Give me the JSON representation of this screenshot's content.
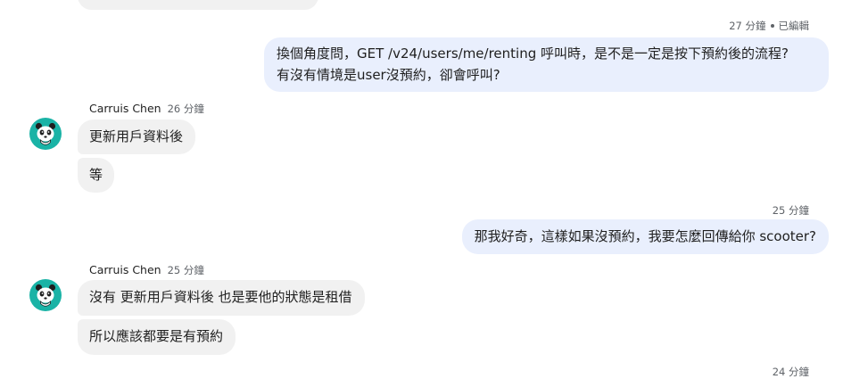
{
  "theme": {
    "incoming_bubble": "#f1f1f1",
    "outgoing_bubble": "#e9effd",
    "avatar_color": "#1ab3a6"
  },
  "messages": {
    "out1": {
      "time": "27 分鐘",
      "status": "已編輯",
      "line1": "換個角度問，GET /v24/users/me/renting 呼叫時，是不是一定是按下預約後的流程?",
      "line2": "有沒有情境是user沒預約，卻會呼叫?"
    },
    "group1": {
      "sender": "Carruis Chen",
      "time": "26 分鐘",
      "avatar_icon": "panda-avatar-icon",
      "msg1": "更新用戶資料後",
      "msg2": "等"
    },
    "out2": {
      "time": "25 分鐘",
      "text": "那我好奇，這樣如果沒預約，我要怎麼回傳給你 scooter?"
    },
    "group2": {
      "sender": "Carruis Chen",
      "time": "25 分鐘",
      "avatar_icon": "panda-avatar-icon",
      "msg1": "沒有 更新用戶資料後 也是要他的狀態是租借",
      "msg2": "所以應該都要是有預約"
    },
    "out3": {
      "time": "24 分鐘"
    }
  }
}
